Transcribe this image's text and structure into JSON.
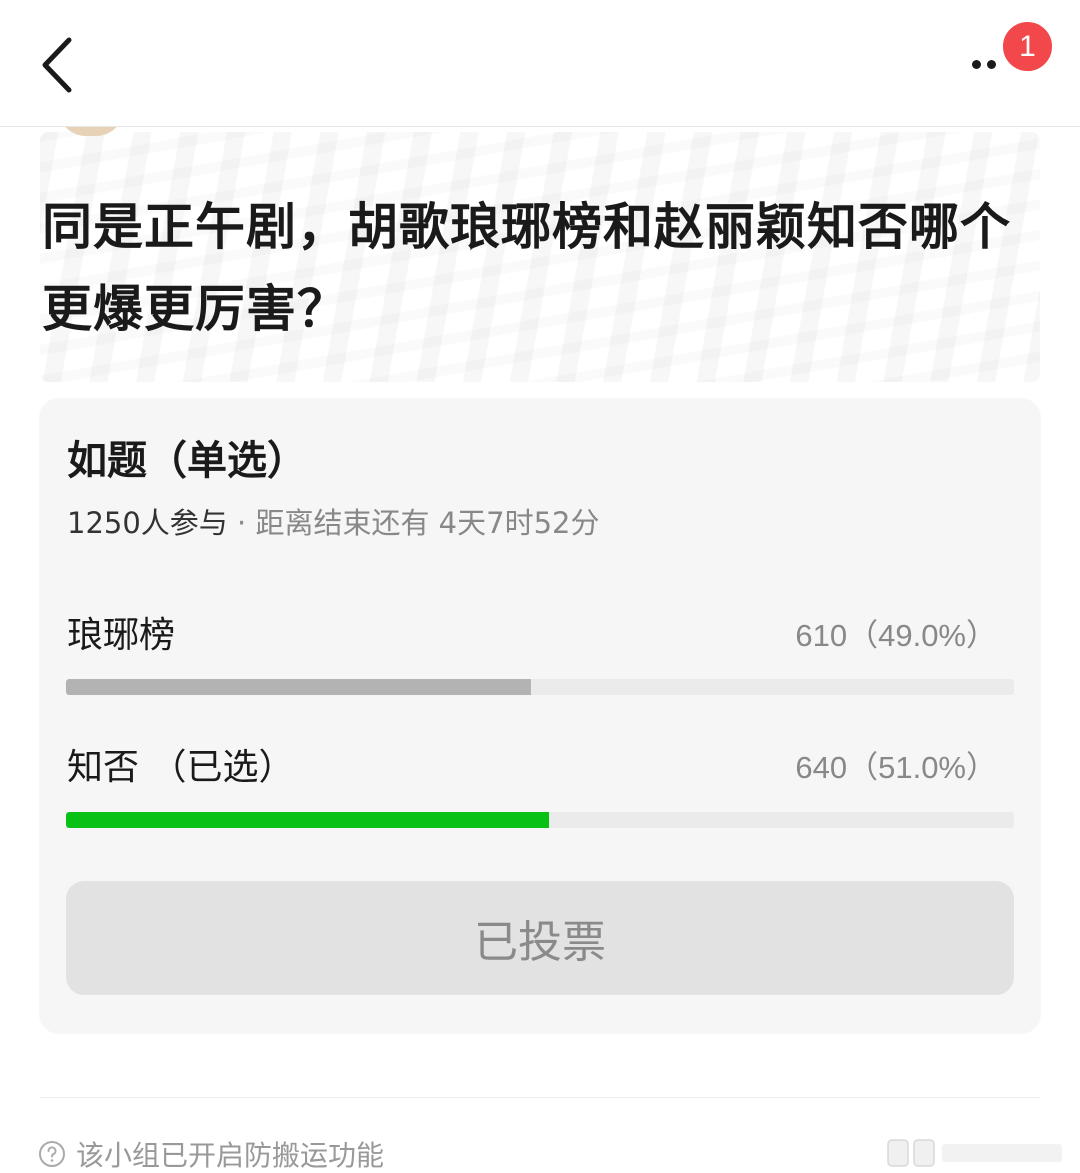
{
  "header": {
    "notification_count": "1"
  },
  "post": {
    "title": "同是正午剧，胡歌琅琊榜和赵丽颖知否哪个更爆更厉害？"
  },
  "poll": {
    "title": "如题（单选）",
    "participants": "1250人参与",
    "separator": " · ",
    "deadline": "距离结束还有 4天7时52分",
    "options": [
      {
        "label": "琅琊榜",
        "result": "610（49.0%）",
        "percent": 49.0,
        "color": "#b3b3b3"
      },
      {
        "label": "知否 （已选）",
        "result": "640（51.0%）",
        "percent": 51.0,
        "color": "#07c114"
      }
    ],
    "voted_label": "已投票"
  },
  "footer": {
    "notice": "该小组已开启防搬运功能"
  }
}
